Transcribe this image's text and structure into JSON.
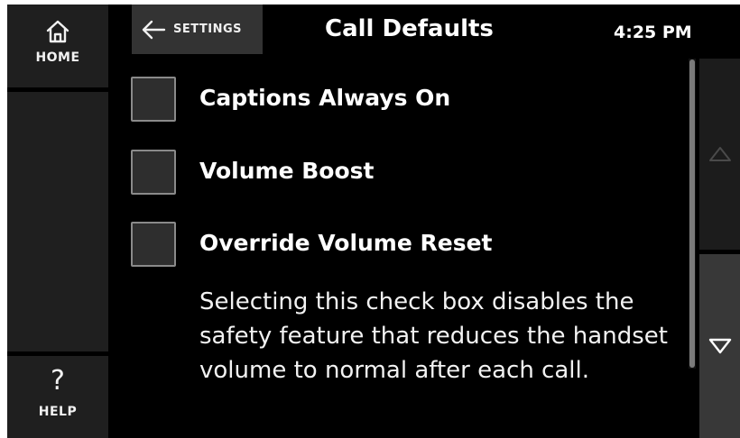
{
  "nav": {
    "home_label": "HOME",
    "help_label": "HELP",
    "help_glyph": "?",
    "home_icon": "home-icon",
    "help_icon": "question-mark-icon"
  },
  "header": {
    "back_label": "SETTINGS",
    "back_icon": "arrow-left-icon",
    "title": "Call Defaults",
    "time": "4:25 PM"
  },
  "options": [
    {
      "label": "Captions Always On",
      "checked": false
    },
    {
      "label": "Volume Boost",
      "checked": false
    },
    {
      "label": "Override Volume Reset",
      "checked": false
    }
  ],
  "description": "Selecting this check box disables the safety feature that reduces the handset volume to normal after each call.",
  "scroll": {
    "up_icon": "triangle-up-icon",
    "down_icon": "triangle-down-icon"
  },
  "colors": {
    "background": "#000000",
    "panel": "#1f1f1f",
    "button": "#333333",
    "text": "#ffffff",
    "checkbox_border": "#8a8a8a"
  }
}
